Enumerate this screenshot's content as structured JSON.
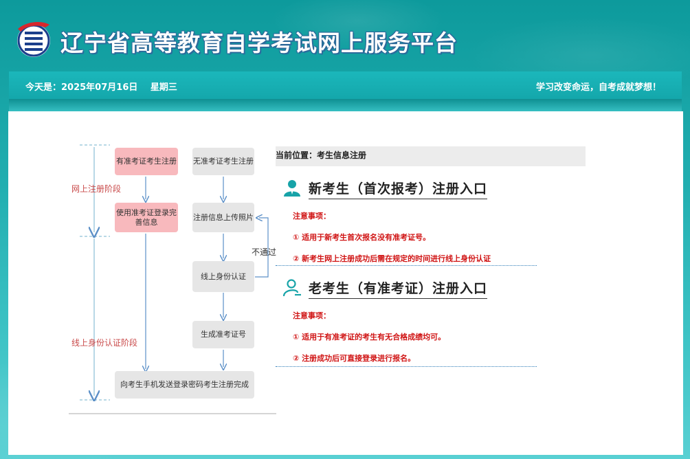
{
  "header": {
    "site_title": "辽宁省高等教育自学考试网上服务平台"
  },
  "infobar": {
    "date_label": "今天是：2025年07月16日",
    "weekday": "星期三",
    "slogan": "学习改变命运，自考成就梦想！"
  },
  "flowchart": {
    "stage_register": "网上注册阶段",
    "stage_verify": "线上身份认证阶段",
    "box_with_ticket": "有准考证考生注册",
    "box_without_ticket": "无准考证考生注册",
    "box_login_complete": "使用准考证登录完善信息",
    "box_upload": "注册信息上传照片",
    "box_identity": "线上身份认证",
    "box_generate": "生成准考证号",
    "box_finish": "向考生手机发送登录密码考生注册完成",
    "label_not_pass": "不通过"
  },
  "content": {
    "breadcrumb": "当前位置：考生信息注册",
    "new_student": {
      "title": "新考生（首次报考）注册入口",
      "notes_heading": "注意事项：",
      "note1": "① 适用于新考生首次报名没有准考证号。",
      "note2": "② 新考生网上注册成功后需在规定的时间进行线上身份认证"
    },
    "old_student": {
      "title": "老考生（有准考证）注册入口",
      "notes_heading": "注意事项：",
      "note1": "① 适用于有准考证的考生有无合格成绩均可。",
      "note2": "② 注册成功后可直接登录进行报名。"
    }
  },
  "colors": {
    "accent": "#17abaf",
    "note_red": "#d01414",
    "pink_box": "#f8b9bd",
    "grey_box": "#e6e6e6"
  }
}
